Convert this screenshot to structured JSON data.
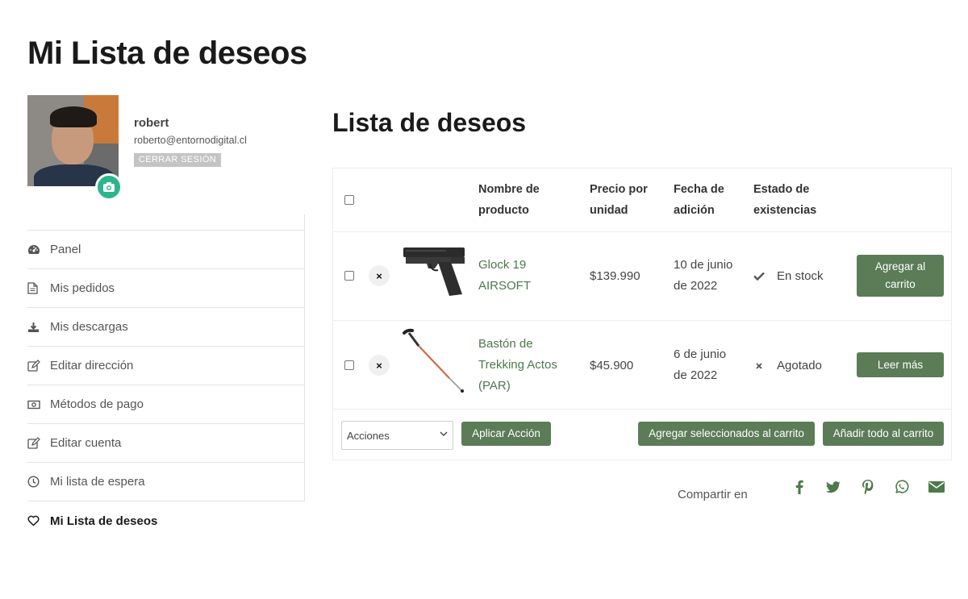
{
  "page": {
    "title": "Mi Lista de deseos"
  },
  "profile": {
    "name": "robert",
    "email": "roberto@entornodigital.cl",
    "logout_label": "CERRAR SESIÓN"
  },
  "nav": {
    "items": [
      {
        "label": "Panel",
        "icon": "dashboard-icon"
      },
      {
        "label": "Mis pedidos",
        "icon": "document-icon"
      },
      {
        "label": "Mis descargas",
        "icon": "download-icon"
      },
      {
        "label": "Editar dirección",
        "icon": "edit-icon"
      },
      {
        "label": "Métodos de pago",
        "icon": "money-icon"
      },
      {
        "label": "Editar cuenta",
        "icon": "edit-icon"
      },
      {
        "label": "Mi lista de espera",
        "icon": "clock-icon"
      },
      {
        "label": "Mi Lista de deseos",
        "icon": "heart-icon",
        "active": true
      }
    ]
  },
  "wishlist": {
    "title": "Lista de deseos",
    "headers": {
      "product_line1": "Nombre de",
      "product_line2": "producto",
      "price_line1": "Precio por",
      "price_line2": "unidad",
      "date_line1": "Fecha de",
      "date_line2": "adición",
      "stock_line1": "Estado de",
      "stock_line2": "existencias"
    },
    "rows": [
      {
        "name_line1": "Glock 19",
        "name_line2": "AIRSOFT",
        "price": "$139.990",
        "date_line1": "10 de junio",
        "date_line2": "de 2022",
        "stock": "En stock",
        "stock_icon": "check-icon",
        "action_line1": "Agregar al",
        "action_line2": "carrito"
      },
      {
        "name_line1": "Bastón de",
        "name_line2": "Trekking Actos",
        "name_line3": "(PAR)",
        "price": "$45.900",
        "date_line1": "6 de junio",
        "date_line2": "de 2022",
        "stock": "Agotado",
        "stock_icon": "x-icon",
        "action": "Leer más"
      }
    ],
    "remove_glyph": "×",
    "actions_select": "Acciones",
    "apply_label": "Aplicar Acción",
    "add_selected_label": "Agregar seleccionados al carrito",
    "add_all_label": "Añadir todo al carrito"
  },
  "share": {
    "label": "Compartir en",
    "networks": [
      "facebook-icon",
      "twitter-icon",
      "pinterest-icon",
      "whatsapp-icon",
      "email-icon"
    ]
  },
  "colors": {
    "accent_green": "#5b7c57",
    "link_green": "#4c7a4a",
    "camera_teal": "#2bb58c"
  }
}
